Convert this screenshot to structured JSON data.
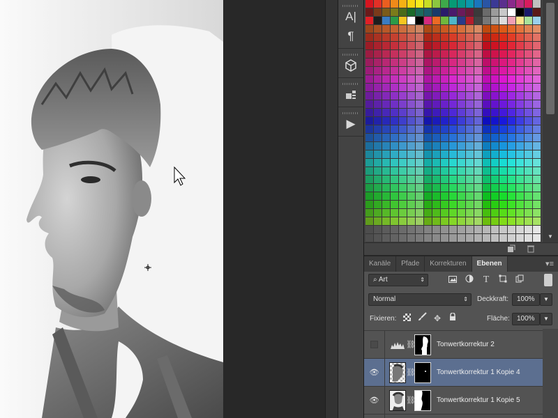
{
  "tools_panel": {
    "buttons": [
      {
        "name": "character-icon",
        "glyph": "A|"
      },
      {
        "name": "paragraph-icon",
        "glyph": "¶"
      },
      {
        "name": "3d-cube-icon",
        "glyph": "⬢"
      },
      {
        "name": "3d-object-icon",
        "glyph": "▦"
      },
      {
        "name": "actions-play-icon",
        "glyph": "▶"
      }
    ]
  },
  "swatches": {
    "top_row": [
      "#d6141f",
      "#e33027",
      "#ea5e20",
      "#f08a19",
      "#f5b114",
      "#f7d611",
      "#f6ec1d",
      "#c7dd25",
      "#8cc640",
      "#3ea94a",
      "#079a75",
      "#06998c",
      "#0b97ad",
      "#1a76bd",
      "#2a55a5",
      "#3b3995",
      "#5b2f8d",
      "#8a2a8b",
      "#b82b7e",
      "#d81c5e",
      "#c0c0c0"
    ],
    "second_row": [
      "#6b1a1a",
      "#7a3a1a",
      "#7b5b1a",
      "#7b7b1a",
      "#4a6b1a",
      "#1a6b2a",
      "#1a6b5b",
      "#1a5b6b",
      "#1a3a6b",
      "#2a1a6b",
      "#4a1a6b",
      "#6b1a5b",
      "#6b1a3a",
      "#3a3a3a",
      "#6b6b6b",
      "#9b9b9b",
      "#c9c9c9",
      "#ffffff",
      "#000000",
      "#1a1a6b",
      "#5b1a1a"
    ]
  },
  "layers_panel": {
    "tabs": [
      {
        "label": "Kanäle",
        "active": false
      },
      {
        "label": "Pfade",
        "active": false
      },
      {
        "label": "Korrekturen",
        "active": false
      },
      {
        "label": "Ebenen",
        "active": true
      }
    ],
    "filter_kind": "Art",
    "blend_mode": "Normal",
    "opacity_label": "Deckkraft:",
    "opacity_value": "100%",
    "lock_label": "Fixieren:",
    "fill_label": "Fläche:",
    "fill_value": "100%",
    "layers": [
      {
        "name": "Tonwertkorrektur 2",
        "visible": false,
        "selected": false,
        "type": "adjustment"
      },
      {
        "name": "Tonwertkorrektur 1 Kopie 4",
        "visible": true,
        "selected": true,
        "type": "masked"
      },
      {
        "name": "Tonwertkorrektur 1 Kopie 5",
        "visible": true,
        "selected": false,
        "type": "masked"
      }
    ]
  },
  "colors": {
    "selected_layer": "#5c6f90",
    "panel_bg": "#535353",
    "dark_bg": "#282828"
  }
}
